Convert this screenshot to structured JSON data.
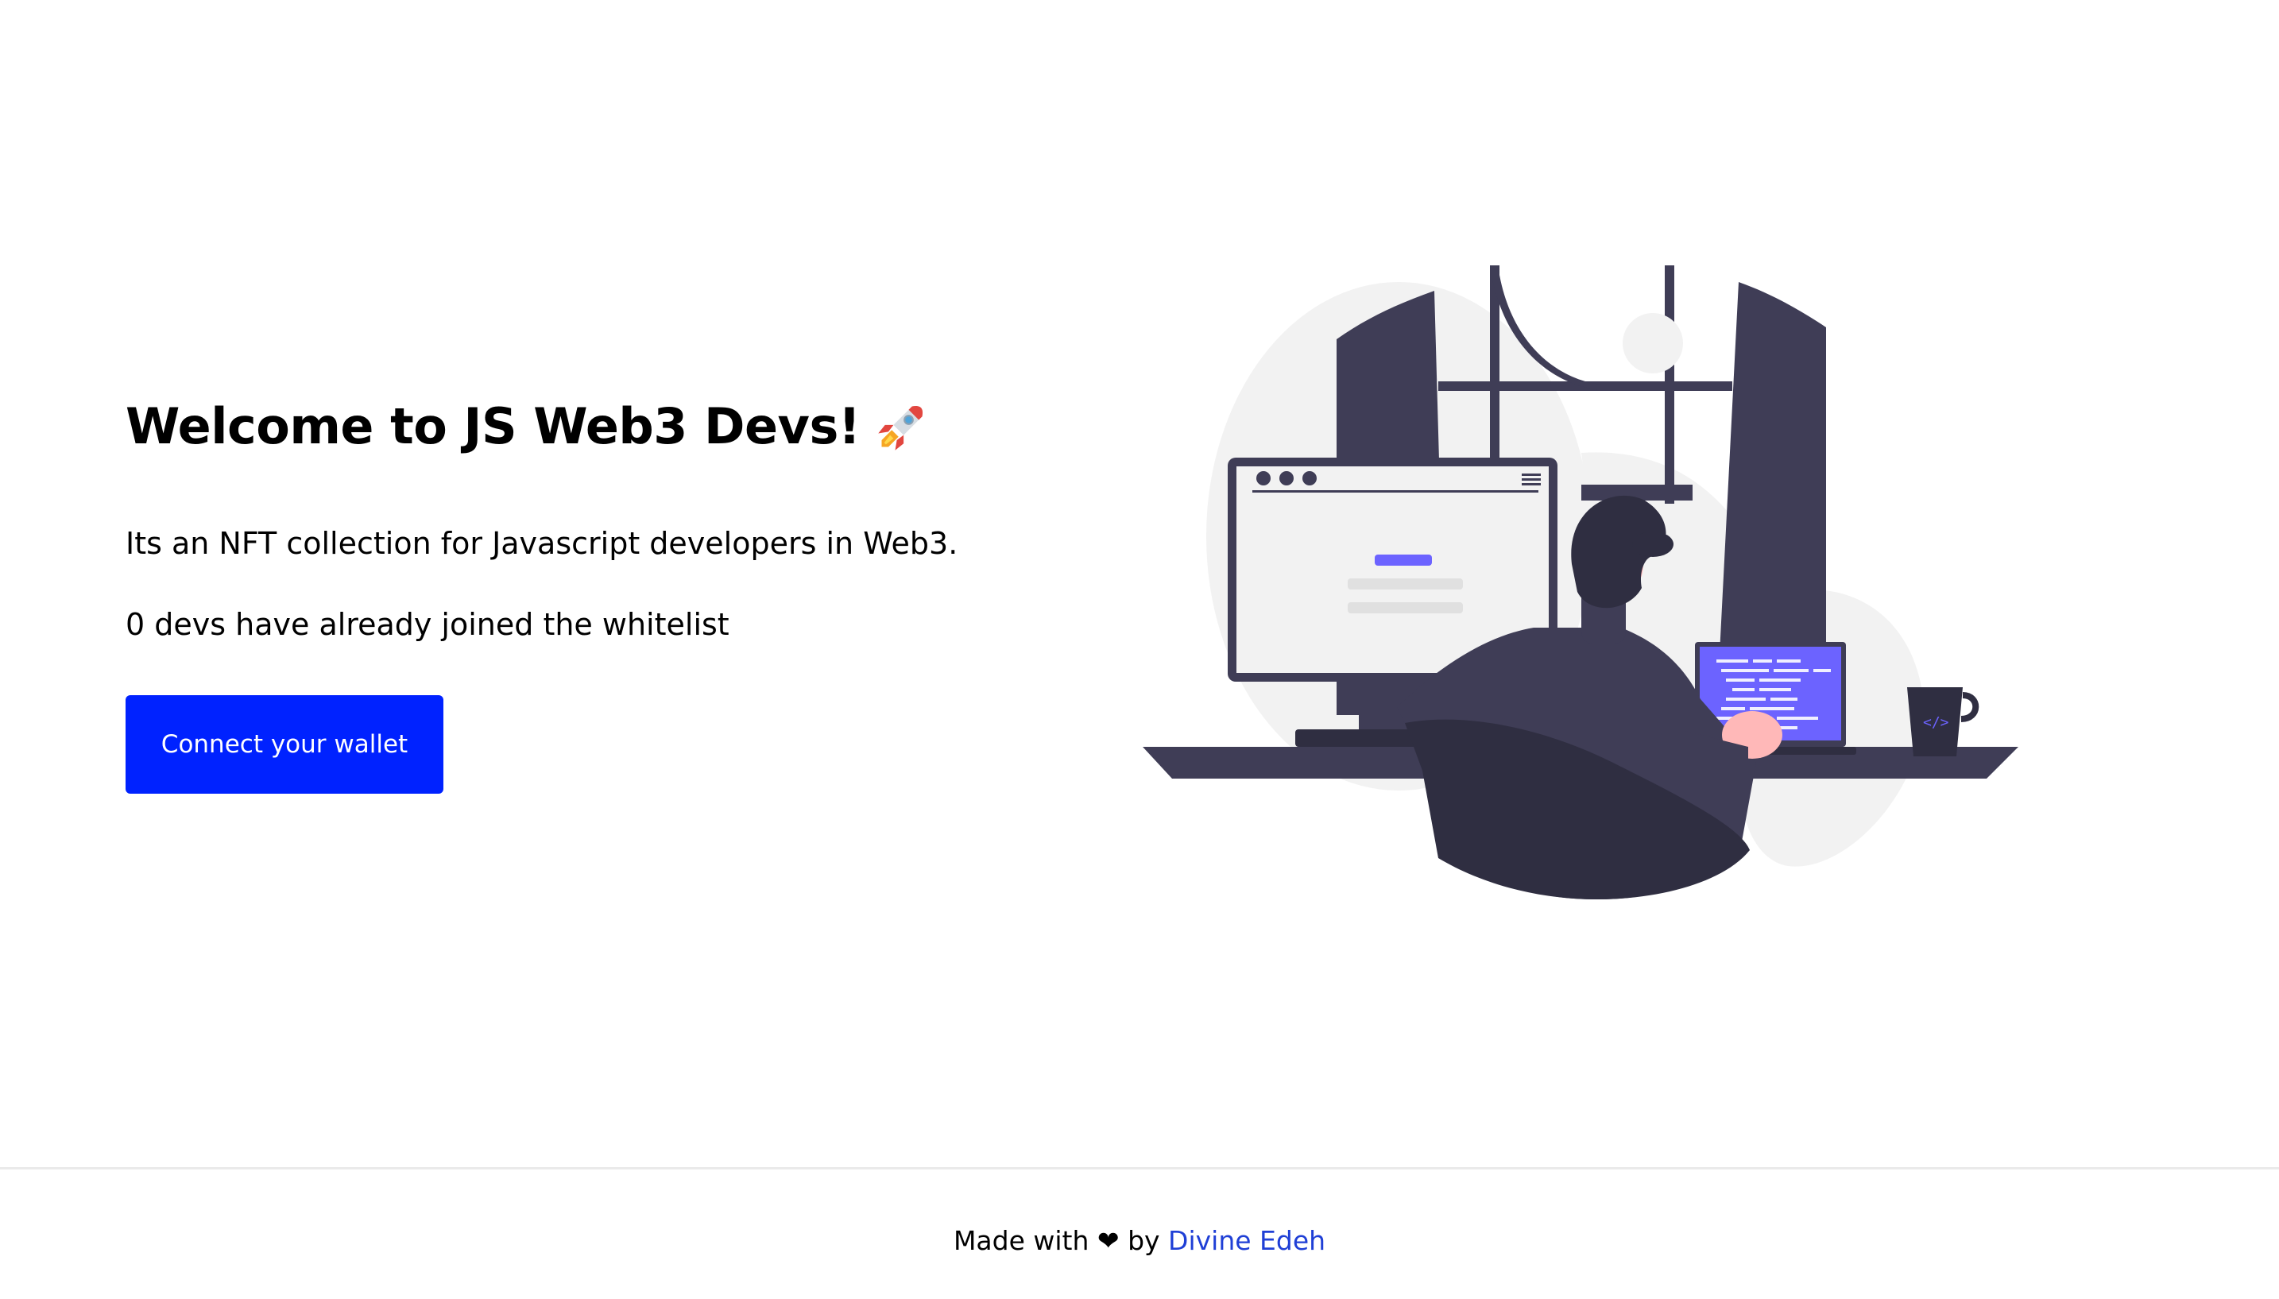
{
  "hero": {
    "title": "Welcome to JS Web3 Devs!",
    "title_emoji": "rocket-icon",
    "description": "Its an NFT collection for Javascript developers in Web3.",
    "whitelist_count": "0 devs have already joined the whitelist",
    "connect_button_label": "Connect your wallet"
  },
  "illustration": {
    "name": "developer-at-desk-illustration"
  },
  "footer": {
    "made_with": "Made with",
    "heart": "❤",
    "by": "by",
    "author_link": "Divine Edeh"
  },
  "colors": {
    "button": "#0022ff",
    "link": "#1f3fd6",
    "accent_purple": "#6c63ff",
    "dark_navy": "#3f3d56"
  }
}
